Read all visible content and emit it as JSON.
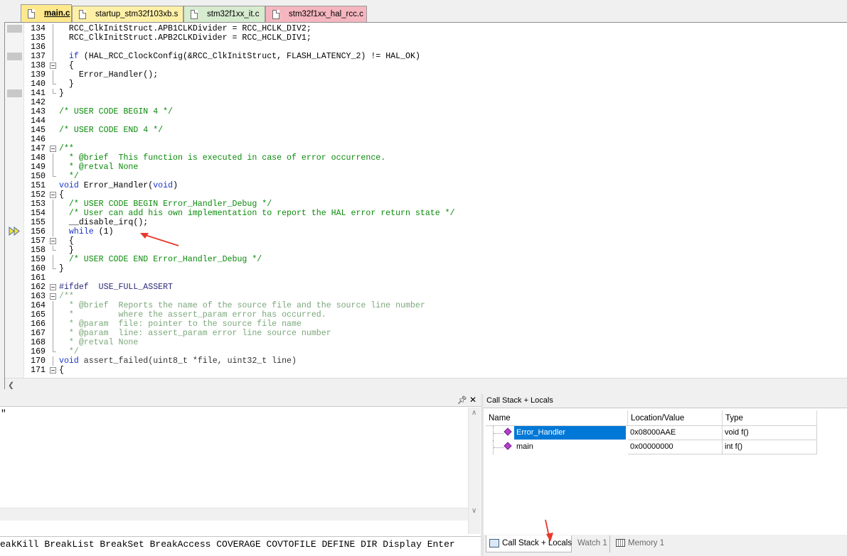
{
  "editor_tabs": [
    {
      "label": "main.c",
      "active": true,
      "color": "#ffe98c"
    },
    {
      "label": "startup_stm32f103xb.s",
      "active": false,
      "color": "#fff0a8"
    },
    {
      "label": "stm32f1xx_it.c",
      "active": false,
      "color": "#d7ebcf"
    },
    {
      "label": "stm32f1xx_hal_rcc.c",
      "active": false,
      "color": "#f5b6bf"
    }
  ],
  "code_lines": [
    {
      "num": "134",
      "text": "  RCC_ClkInitStruct.APB1CLKDivider = RCC_HCLK_DIV2;"
    },
    {
      "num": "135",
      "text": "  RCC_ClkInitStruct.APB2CLKDivider = RCC_HCLK_DIV1;"
    },
    {
      "num": "136",
      "text": ""
    },
    {
      "num": "137",
      "text": "  if (HAL_RCC_ClockConfig(&RCC_ClkInitStruct, FLASH_LATENCY_2) != HAL_OK)"
    },
    {
      "num": "138",
      "text": "  {"
    },
    {
      "num": "139",
      "text": "    Error_Handler();"
    },
    {
      "num": "140",
      "text": "  }"
    },
    {
      "num": "141",
      "text": "}"
    },
    {
      "num": "142",
      "text": ""
    },
    {
      "num": "143",
      "text": "/* USER CODE BEGIN 4 */"
    },
    {
      "num": "144",
      "text": ""
    },
    {
      "num": "145",
      "text": "/* USER CODE END 4 */"
    },
    {
      "num": "146",
      "text": ""
    },
    {
      "num": "147",
      "text": "/**"
    },
    {
      "num": "148",
      "text": "  * @brief  This function is executed in case of error occurrence."
    },
    {
      "num": "149",
      "text": "  * @retval None"
    },
    {
      "num": "150",
      "text": "  */"
    },
    {
      "num": "151",
      "text": "void Error_Handler(void)"
    },
    {
      "num": "152",
      "text": "{"
    },
    {
      "num": "153",
      "text": "  /* USER CODE BEGIN Error_Handler_Debug */"
    },
    {
      "num": "154",
      "text": "  /* User can add his own implementation to report the HAL error return state */"
    },
    {
      "num": "155",
      "text": "  __disable_irq();"
    },
    {
      "num": "156",
      "text": "  while (1)"
    },
    {
      "num": "157",
      "text": "  {"
    },
    {
      "num": "158",
      "text": "  }"
    },
    {
      "num": "159",
      "text": "  /* USER CODE END Error_Handler_Debug */"
    },
    {
      "num": "160",
      "text": "}"
    },
    {
      "num": "161",
      "text": ""
    },
    {
      "num": "162",
      "text": "#ifdef  USE_FULL_ASSERT"
    },
    {
      "num": "163",
      "text": "/**"
    },
    {
      "num": "164",
      "text": "  * @brief  Reports the name of the source file and the source line number"
    },
    {
      "num": "165",
      "text": "  *         where the assert_param error has occurred."
    },
    {
      "num": "166",
      "text": "  * @param  file: pointer to the source file name"
    },
    {
      "num": "167",
      "text": "  * @param  line: assert_param error line source number"
    },
    {
      "num": "168",
      "text": "  * @retval None"
    },
    {
      "num": "169",
      "text": "  */"
    },
    {
      "num": "170",
      "text": "void assert_failed(uint8_t *file, uint32_t line)"
    },
    {
      "num": "171",
      "text": "{"
    }
  ],
  "command_window": {
    "output_text": "\"",
    "command_line": "eakKill BreakList BreakSet BreakAccess COVERAGE COVTOFILE DEFINE DIR Display Enter"
  },
  "call_stack": {
    "title": "Call Stack + Locals",
    "columns": [
      "Name",
      "Location/Value",
      "Type"
    ],
    "rows": [
      {
        "name": "Error_Handler",
        "location": "0x08000AAE",
        "type": "void f()",
        "selected": true
      },
      {
        "name": "main",
        "location": "0x00000000",
        "type": "int f()",
        "selected": false
      }
    ]
  },
  "bottom_tabs": [
    {
      "label": "Call Stack + Locals",
      "active": true
    },
    {
      "label": "Watch 1",
      "active": false
    },
    {
      "label": "Memory 1",
      "active": false
    }
  ],
  "icons": {
    "pin": "pin-icon",
    "close": "close-icon",
    "current_execution": "execution-arrow-icon"
  },
  "colors": {
    "comment": "#0b8a0b",
    "keyword": "#1a35c8",
    "selection": "#0078d7",
    "annotation_arrow": "#e8372c"
  }
}
